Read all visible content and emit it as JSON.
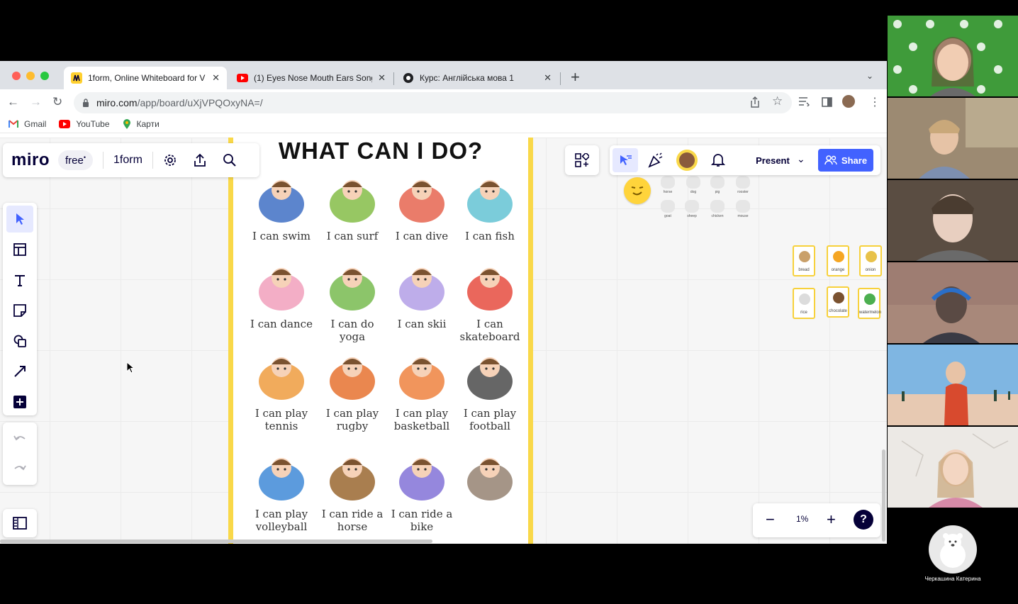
{
  "browser": {
    "tabs": [
      {
        "title": "1form, Online Whiteboard for V",
        "favicon": "miro-icon",
        "active": true
      },
      {
        "title": "(1) Eyes Nose Mouth Ears Song",
        "favicon": "youtube-icon",
        "active": false
      },
      {
        "title": "Курс: Англійська мова 1",
        "favicon": "course-icon",
        "active": false
      }
    ],
    "url_host": "miro.com",
    "url_path": "/app/board/uXjVPQOxyNA=/",
    "bookmarks": [
      {
        "label": "Gmail",
        "icon": "gmail-icon"
      },
      {
        "label": "YouTube",
        "icon": "youtube-icon"
      },
      {
        "label": "Карти",
        "icon": "maps-icon"
      }
    ]
  },
  "miro": {
    "logo": "miro",
    "plan": "free",
    "board_name": "1form",
    "present_label": "Present",
    "share_label": "Share",
    "zoom": "1%",
    "help": "?",
    "accent": "#4262ff"
  },
  "poster": {
    "title": "WHAT CAN I DO?",
    "cards": [
      {
        "caption": "I can swim",
        "color": "#4a78c8"
      },
      {
        "caption": "I can surf",
        "color": "#8cc152"
      },
      {
        "caption": "I can dive",
        "color": "#e86e5a"
      },
      {
        "caption": "I can fish",
        "color": "#6dc7d6"
      },
      {
        "caption": "I can dance",
        "color": "#f2a5c0"
      },
      {
        "caption": "I can do yoga",
        "color": "#7fbf5a"
      },
      {
        "caption": "I can skii",
        "color": "#b7a4e8"
      },
      {
        "caption": "I can skateboard",
        "color": "#e8564a"
      },
      {
        "caption": "I can play tennis",
        "color": "#f0a24a"
      },
      {
        "caption": "I can play rugby",
        "color": "#e87a3c"
      },
      {
        "caption": "I can play basketball",
        "color": "#f08a4a"
      },
      {
        "caption": "I can play football",
        "color": "#555555"
      },
      {
        "caption": "I can play volleyball",
        "color": "#4a90d9"
      },
      {
        "caption": "I can ride a horse",
        "color": "#a0703c"
      },
      {
        "caption": "I can ride a bike",
        "color": "#8a7ad9"
      },
      {
        "caption": "",
        "color": "#9b8a7a"
      }
    ]
  },
  "board_items": {
    "animals": [
      "horse",
      "dog",
      "pig",
      "rooster",
      "goat",
      "sheep",
      "chicken",
      "mouse"
    ],
    "food": [
      {
        "label": "bread",
        "color": "#c9a06a"
      },
      {
        "label": "orange",
        "color": "#f5a623"
      },
      {
        "label": "onion",
        "color": "#e8c24a"
      },
      {
        "label": "rice",
        "color": "#dcdcdc"
      },
      {
        "label": "chocolate",
        "color": "#7a5230"
      },
      {
        "label": "watermelon",
        "color": "#4caf50"
      }
    ]
  },
  "participants": {
    "self_name": "Черкашина Катерина"
  }
}
